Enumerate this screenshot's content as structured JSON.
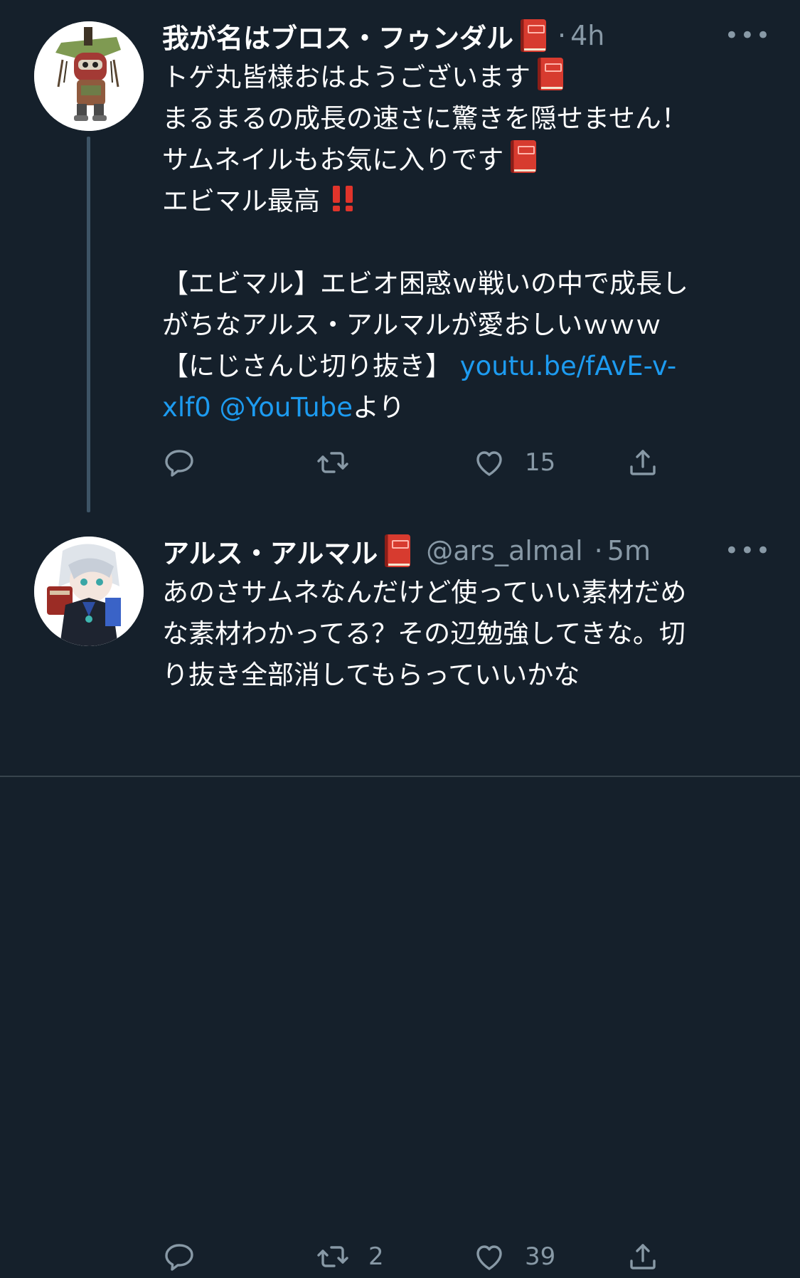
{
  "colors": {
    "background": "#15202b",
    "text": "#ffffff",
    "secondary": "#8899a6",
    "link": "#1d9bf0",
    "thread_line": "#3d5466",
    "book_emoji": "#d73b2f",
    "double_exclamation_emoji": "#e0342b"
  },
  "tweets": [
    {
      "author": {
        "display_name": "我が名はブロス・フゥンダル",
        "name_emoji": "book-emoji"
      },
      "dot": "·",
      "time": "4h",
      "more": "•••",
      "body": {
        "line1": "トゲ丸皆様おはようございます",
        "line2": "まるまるの成長の速さに驚きを隠せません！",
        "line3": "サムネイルもお気に入りです",
        "line4": "エビマル最高",
        "line5": "【エビマル】エビオ困惑ｗ戦いの中で成長し",
        "line6": "がちなアルス・アルマルが愛おしいｗｗｗ",
        "line7_text": "【にじさんじ切り抜き】 ",
        "line7_link": "youtu.be/fAvE-v-",
        "line8_link1": "xlf0",
        "line8_link2": "@YouTube",
        "line8_text": "より"
      },
      "actions": {
        "reply_count": "",
        "retweet_count": "",
        "like_count": "15"
      }
    },
    {
      "author": {
        "display_name": "アルス・アルマル",
        "name_emoji": "book-emoji",
        "handle": "@ars_almal"
      },
      "dot": "·",
      "time": "5m",
      "more": "•••",
      "body": {
        "line1": "あのさサムネなんだけど使っていい素材だめ",
        "line2": "な素材わかってる？その辺勉強してきな。切",
        "line3": "り抜き全部消してもらっていいかな"
      },
      "actions": {
        "reply_count": "",
        "retweet_count": "2",
        "like_count": "39"
      }
    }
  ]
}
